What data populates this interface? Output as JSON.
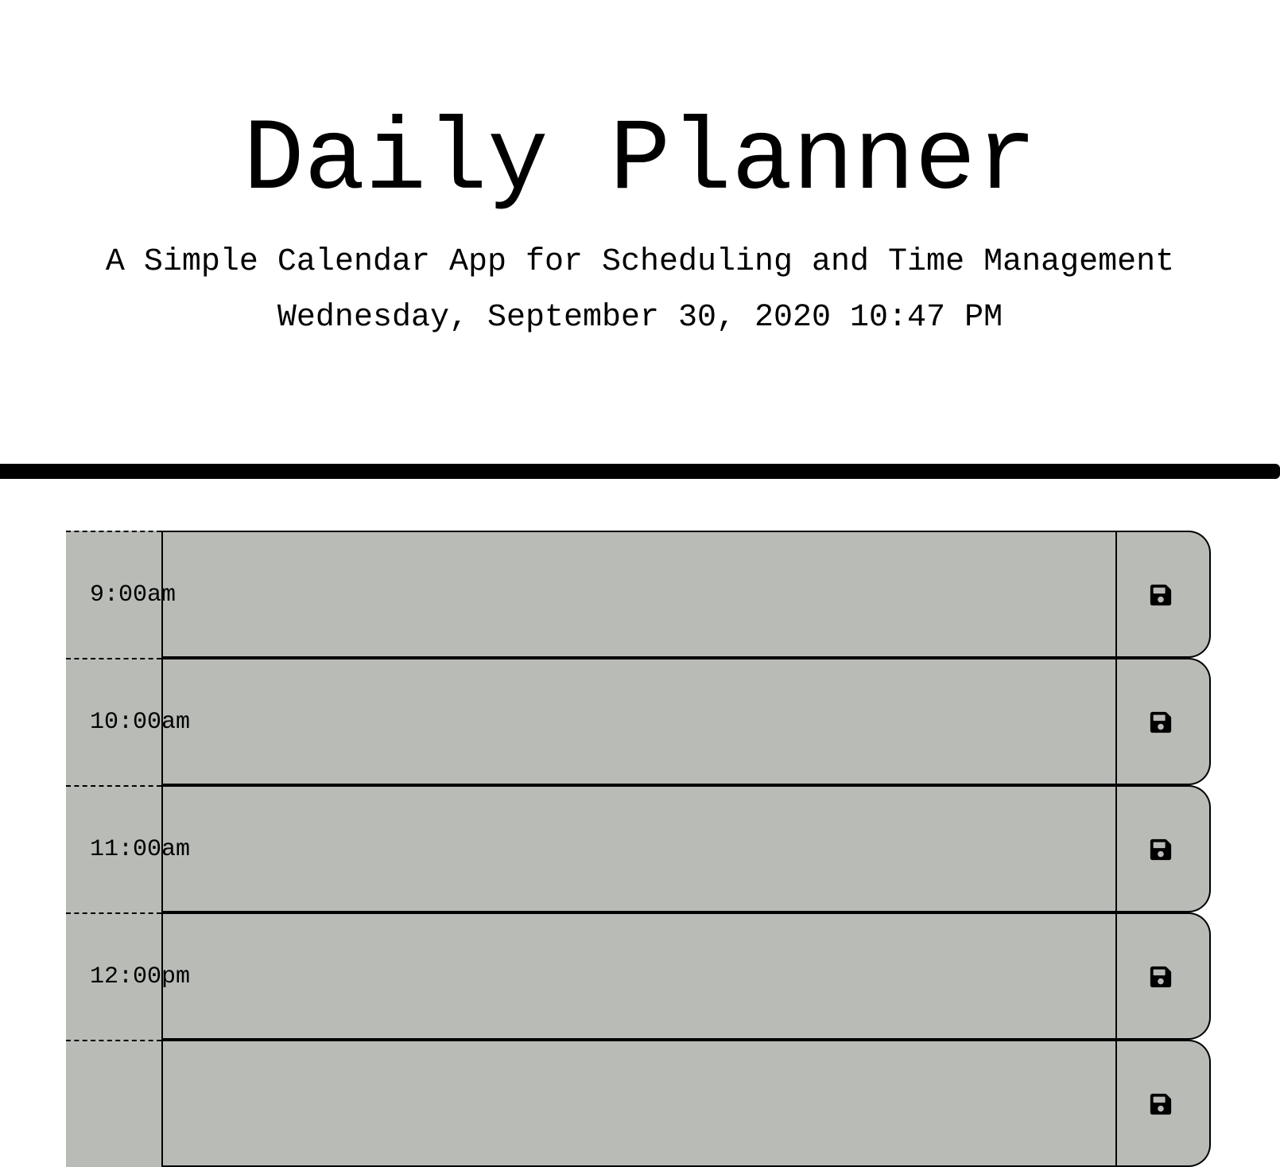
{
  "header": {
    "title": "Daily Planner",
    "subtitle": "A Simple Calendar App for Scheduling and Time Management",
    "current_datetime": "Wednesday, September 30, 2020 10:47 PM"
  },
  "planner": {
    "rows": [
      {
        "hour": "9:00am",
        "description": "",
        "status": "past"
      },
      {
        "hour": "10:00am",
        "description": "",
        "status": "past"
      },
      {
        "hour": "11:00am",
        "description": "",
        "status": "past"
      },
      {
        "hour": "12:00pm",
        "description": "",
        "status": "past"
      },
      {
        "hour": "",
        "description": "",
        "status": "past"
      }
    ],
    "save_icon": "floppy-disk-icon"
  },
  "colors": {
    "past": "#b9bcb6",
    "divider": "#000000"
  }
}
